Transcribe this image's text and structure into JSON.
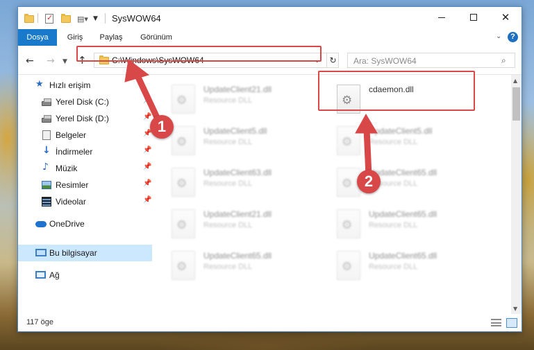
{
  "window": {
    "title": "SysWOW64"
  },
  "ribbon": {
    "tabs": [
      "Dosya",
      "Giriş",
      "Paylaş",
      "Görünüm"
    ],
    "help_label": "?"
  },
  "navbar": {
    "address": "C:\\Windows\\SysWOW64",
    "search_placeholder": "Ara: SysWOW64"
  },
  "sidebar": {
    "items": [
      {
        "label": "Hızlı erişim",
        "icon": "star-icon"
      },
      {
        "label": "Yerel Disk (C:)",
        "icon": "drive-icon",
        "pinned": true
      },
      {
        "label": "Yerel Disk (D:)",
        "icon": "drive-icon",
        "pinned": true
      },
      {
        "label": "Belgeler",
        "icon": "documents-icon",
        "pinned": true
      },
      {
        "label": "İndirmeler",
        "icon": "download-icon",
        "pinned": true
      },
      {
        "label": "Müzik",
        "icon": "music-icon",
        "pinned": true
      },
      {
        "label": "Resimler",
        "icon": "pictures-icon",
        "pinned": true
      },
      {
        "label": "Videolar",
        "icon": "videos-icon",
        "pinned": true
      },
      {
        "label": "OneDrive",
        "icon": "cloud-icon"
      },
      {
        "label": "Bu bilgisayar",
        "icon": "computer-icon",
        "selected": true
      },
      {
        "label": "Ağ",
        "icon": "network-icon"
      }
    ]
  },
  "files": [
    {
      "name": "UpdateClient21.dll",
      "type": "Resource DLL",
      "blurred": true
    },
    {
      "name": "cdaemon.dll",
      "type": "",
      "blurred": false,
      "highlighted": true
    },
    {
      "name": "UpdateClient5.dll",
      "type": "Resource DLL",
      "blurred": true
    },
    {
      "name": "UpdateClient5.dll",
      "type": "Resource DLL",
      "blurred": true
    },
    {
      "name": "UpdateClient63.dll",
      "type": "Resource DLL",
      "blurred": true
    },
    {
      "name": "UpdateClient65.dll",
      "type": "Resource DLL",
      "blurred": true
    },
    {
      "name": "UpdateClient21.dll",
      "type": "Resource DLL",
      "blurred": true
    },
    {
      "name": "UpdateClient65.dll",
      "type": "Resource DLL",
      "blurred": true
    },
    {
      "name": "UpdateClient65.dll",
      "type": "Resource DLL",
      "blurred": true
    },
    {
      "name": "UpdateClient65.dll",
      "type": "Resource DLL",
      "blurred": true
    }
  ],
  "status": {
    "item_count": "117 öge"
  },
  "annotations": {
    "marker_1": "1",
    "marker_2": "2",
    "color": "#d94848"
  },
  "colors": {
    "accent": "#1979ca",
    "selection": "#cce8ff",
    "highlight": "#d94848"
  }
}
